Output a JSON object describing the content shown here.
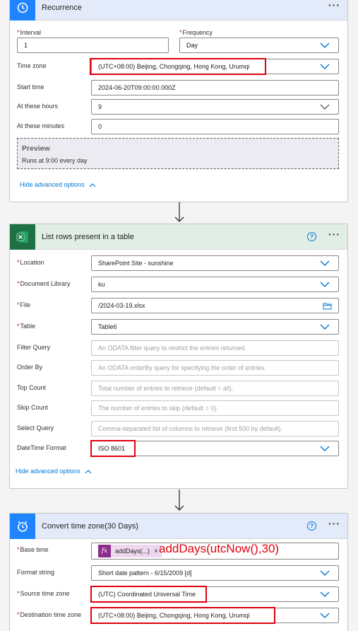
{
  "recurrence": {
    "title": "Recurrence",
    "more": "···",
    "interval_label": "Interval",
    "interval_value": "1",
    "frequency_label": "Frequency",
    "frequency_value": "Day",
    "timezone_label": "Time zone",
    "timezone_value": "(UTC+08:00) Beijing, Chongqing, Hong Kong, Urumqi",
    "start_label": "Start time",
    "start_value": "2024-06-20T09:00:00.000Z",
    "hours_label": "At these hours",
    "hours_value": "9",
    "minutes_label": "At these minutes",
    "minutes_value": "0",
    "preview_title": "Preview",
    "preview_text": "Runs at 9:00 every day",
    "hide_link": "Hide advanced options"
  },
  "list_rows": {
    "title": "List rows present in a table",
    "help": "?",
    "more": "···",
    "location_label": "Location",
    "location_value": "SharePoint Site - sunshine",
    "doclib_label": "Document Library",
    "doclib_value": "ku",
    "file_label": "File",
    "file_value": "/2024-03-19.xlsx",
    "table_label": "Table",
    "table_value": "Table6",
    "filter_label": "Filter Query",
    "filter_placeholder": "An ODATA filter query to restrict the entries returned.",
    "orderby_label": "Order By",
    "orderby_placeholder": "An ODATA orderBy query for specifying the order of entries.",
    "top_label": "Top Count",
    "top_placeholder": "Total number of entries to retrieve (default = all).",
    "skip_label": "Skip Count",
    "skip_placeholder": "The number of entries to skip (default = 0).",
    "select_label": "Select Query",
    "select_placeholder": "Comma-separated list of columns to retrieve (first 500 by default).",
    "datetime_label": "DateTime Format",
    "datetime_value": "ISO 8601",
    "hide_link": "Hide advanced options"
  },
  "convert": {
    "title": "Convert time zone(30 Days)",
    "help": "?",
    "more": "···",
    "base_label": "Base time",
    "base_token": "addDays(...)",
    "base_token_close": "×",
    "base_annotation": "addDays(utcNow(),30)",
    "format_label": "Format string",
    "format_value": "Short date pattern - 6/15/2009 [d]",
    "source_label": "Source time zone",
    "source_value": "(UTC) Coordinated Universal Time",
    "dest_label": "Destination time zone",
    "dest_value": "(UTC+08:00) Beijing, Chongqing, Hong Kong, Urumqi"
  },
  "required_mark": "*",
  "colors": {
    "accent": "#0078d4",
    "highlight": "#e00010",
    "expression_token": "#f0d7f0"
  }
}
